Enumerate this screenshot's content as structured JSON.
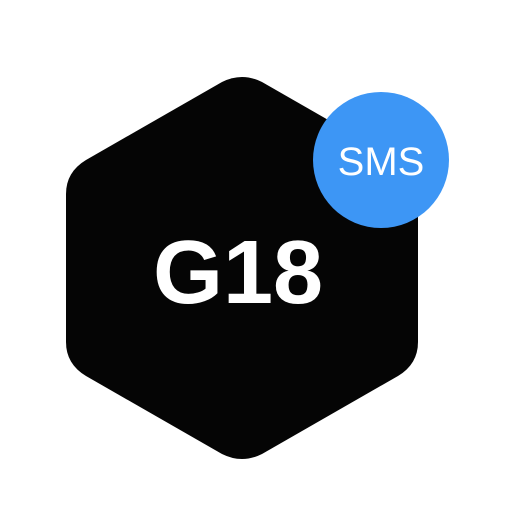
{
  "app_icon": {
    "main_text": "G18",
    "badge_text": "SMS",
    "colors": {
      "background": "#ffffff",
      "hexagon": "#050505",
      "main_text": "#ffffff",
      "badge": "#3d96f5",
      "badge_text": "#ffffff"
    }
  }
}
